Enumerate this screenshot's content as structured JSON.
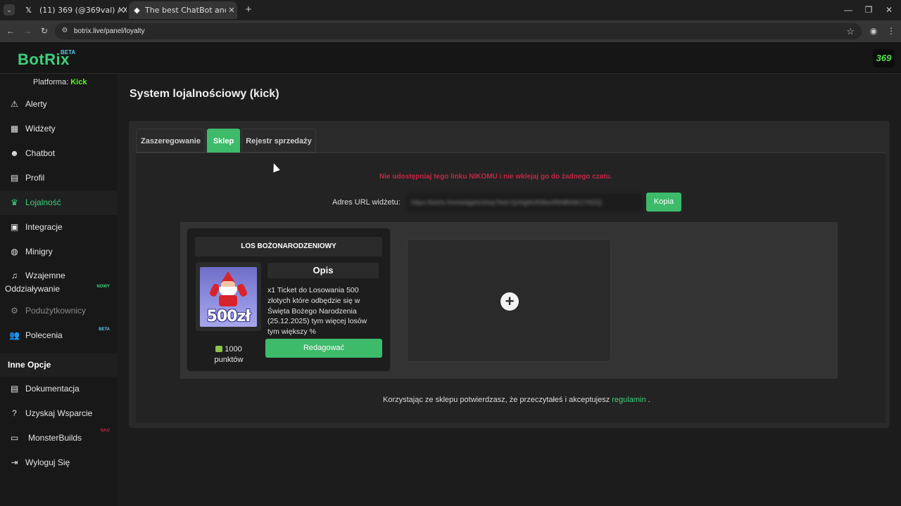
{
  "browser": {
    "tabs": [
      {
        "title": "(11) 369 (@369val) / X",
        "icon": "x-logo-icon",
        "active": false
      },
      {
        "title": "The best ChatBot and Widgets",
        "icon": "botrix-favicon-icon",
        "active": true
      }
    ],
    "new_tab_symbol": "+",
    "url": "botrix.live/panel/loyalty"
  },
  "app": {
    "logo": "BotRix",
    "logo_badge": "BETA",
    "avatar_text": "369",
    "accent_color": "#3dd07c",
    "danger_color": "#c32647"
  },
  "sidebar": {
    "platform_label": "Platforma:",
    "platform_value": "Kick",
    "items": [
      {
        "label": "Alerty",
        "icon": "warning-triangle-icon"
      },
      {
        "label": "Widżety",
        "icon": "grid-icon"
      },
      {
        "label": "Chatbot",
        "icon": "robot-icon"
      },
      {
        "label": "Profil",
        "icon": "id-card-icon"
      },
      {
        "label": "Lojalność",
        "icon": "trophy-icon",
        "active": true
      },
      {
        "label": "Integracje",
        "icon": "plug-icon"
      },
      {
        "label": "Minigry",
        "icon": "gamepad-icon"
      },
      {
        "label": "Wzajemne",
        "label2": "Oddziaływanie",
        "icon": "music-icon",
        "badge": "NOWY"
      },
      {
        "label": "Podużytkownicy",
        "icon": "users-cog-icon",
        "disabled": true
      },
      {
        "label": "Polecenia",
        "icon": "users-icon",
        "badge": "BETA"
      }
    ],
    "section_title": "Inne Opcje",
    "other_items": [
      {
        "label": "Dokumentacja",
        "icon": "book-icon"
      },
      {
        "label": "Uzyskaj Wsparcie",
        "icon": "question-circle-icon"
      },
      {
        "label": "MonsterBuilds",
        "icon": "laptop-icon",
        "badge": "NAO"
      },
      {
        "label": "Wyloguj Się",
        "icon": "sign-out-icon"
      }
    ]
  },
  "main": {
    "title": "System lojalnościowy (kick)",
    "tabs": [
      {
        "label": "Zaszeregowanie"
      },
      {
        "label": "Sklep",
        "active": true
      },
      {
        "label": "Rejestr sprzedaży"
      }
    ],
    "warning": "Nie udostępniaj tego linku NIKOMU i nie wklejaj go do żadnego czatu.",
    "widget_url_label": "Adres URL widżetu:",
    "widget_url_value": "https://botrix.live/widgets/shop?bid=QzNgNiJKBwvRtNBhNK1Yt62Q",
    "copy_button": "Kopia",
    "shop_item": {
      "title": "LOS BOŻONARODZENIOWY",
      "image_price_text": "500zł",
      "description_heading": "Opis",
      "description": "x1 Ticket do Losowania 500 złotych które odbędzie się w Święta Bożego Narodzenia (25.12.2025) tym więcej losów tym większy %",
      "points_value": "1000",
      "points_unit": "punktów",
      "edit_button": "Redagować"
    },
    "add_item_icon": "plus-circle-icon",
    "footer_text": "Korzystając ze sklepu potwierdzasz, że przeczytałeś i akceptujesz",
    "footer_link": "regulamin",
    "footer_end": "."
  }
}
